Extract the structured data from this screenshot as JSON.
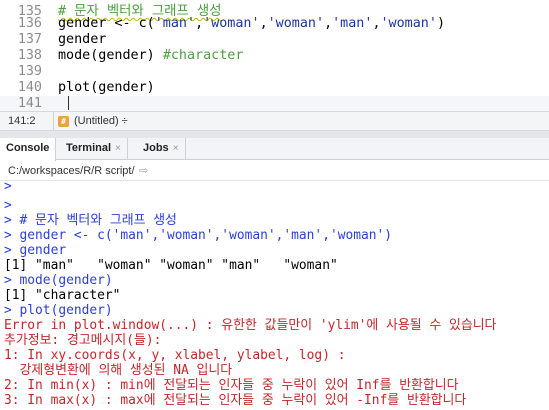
{
  "editor": {
    "lines": [
      {
        "no": "135",
        "segments": [
          {
            "cls": "comment",
            "text": "# 문자 벡터와 그래프 생성"
          }
        ]
      },
      {
        "no": "136",
        "segments": [
          {
            "cls": "op",
            "text": "gender <- c("
          },
          {
            "cls": "string",
            "text": "'man'"
          },
          {
            "cls": "op",
            "text": ","
          },
          {
            "cls": "string",
            "text": "'woman'"
          },
          {
            "cls": "op",
            "text": ","
          },
          {
            "cls": "string",
            "text": "'woman'"
          },
          {
            "cls": "op",
            "text": ","
          },
          {
            "cls": "string",
            "text": "'man'"
          },
          {
            "cls": "op",
            "text": ","
          },
          {
            "cls": "string",
            "text": "'woman'"
          },
          {
            "cls": "op",
            "text": ")"
          }
        ]
      },
      {
        "no": "137",
        "segments": [
          {
            "cls": "op",
            "text": "gender"
          }
        ]
      },
      {
        "no": "138",
        "segments": [
          {
            "cls": "op",
            "text": "mode(gender) "
          },
          {
            "cls": "comment",
            "text": "#character"
          }
        ]
      },
      {
        "no": "139",
        "segments": []
      },
      {
        "no": "140",
        "segments": [
          {
            "cls": "op",
            "text": "plot(gender)"
          }
        ]
      },
      {
        "no": "141",
        "segments": []
      }
    ]
  },
  "statusbar": {
    "position": "141:2",
    "scope_icon": "#",
    "scope": "(Untitled) ÷"
  },
  "tabs": [
    {
      "label": "Console",
      "close": ""
    },
    {
      "label": "Terminal",
      "close": "×"
    },
    {
      "label": "Jobs",
      "close": "×"
    }
  ],
  "path": {
    "text": "C:/workspaces/R/R script/",
    "arrow": "⇨"
  },
  "console": {
    "lines": [
      {
        "cls": "prompt",
        "text": ">"
      },
      {
        "cls": "prompt",
        "text": ">"
      },
      {
        "cls": "echo",
        "text": "> # 문자 벡터와 그래프 생성"
      },
      {
        "cls": "echo",
        "text": "> gender <- c('man','woman','woman','man','woman')"
      },
      {
        "cls": "echo",
        "text": "> gender"
      },
      {
        "cls": "output",
        "text": "[1] \"man\"   \"woman\" \"woman\" \"man\"   \"woman\""
      },
      {
        "cls": "echo",
        "text": "> mode(gender)"
      },
      {
        "cls": "output",
        "text": "[1] \"character\""
      },
      {
        "cls": "echo",
        "text": "> plot(gender)"
      },
      {
        "cls": "error",
        "text": "Error in plot.window(...) : 유한한 값들만이 'ylim'에 사용될 수 있습니다"
      },
      {
        "cls": "error",
        "text": "추가정보: 경고메시지(들):"
      },
      {
        "cls": "error",
        "text": "1: In xy.coords(x, y, xlabel, ylabel, log) :"
      },
      {
        "cls": "error",
        "text": "  강제형변환에 의해 생성된 NA 입니다"
      },
      {
        "cls": "error",
        "text": "2: In min(x) : min에 전달되는 인자들 중 누락이 있어 Inf를 반환합니다"
      },
      {
        "cls": "error",
        "text": "3: In max(x) : max에 전달되는 인자들 중 누락이 있어 -Inf를 반환합니다"
      }
    ]
  }
}
